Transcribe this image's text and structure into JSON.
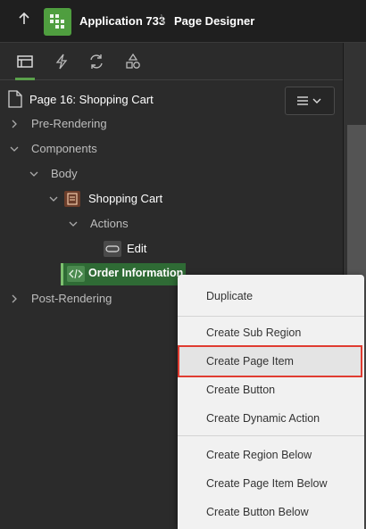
{
  "header": {
    "app_title": "Application 733",
    "separator": "\\",
    "page_title": "Page Designer"
  },
  "tabs": [
    {
      "name": "rendering",
      "icon": "rendering-tree-icon",
      "active": true
    },
    {
      "name": "dynamic-actions",
      "icon": "lightning-icon",
      "active": false
    },
    {
      "name": "processing",
      "icon": "refresh-icon",
      "active": false
    },
    {
      "name": "shared-components",
      "icon": "shapes-icon",
      "active": false
    }
  ],
  "tree": {
    "root_label": "Page 16: Shopping Cart",
    "pre_rendering": "Pre-Rendering",
    "components": "Components",
    "body": "Body",
    "shopping_cart": "Shopping Cart",
    "actions": "Actions",
    "edit": "Edit",
    "order_information": "Order Information",
    "post_rendering": "Post-Rendering"
  },
  "context_menu": {
    "items": [
      "Duplicate",
      "Create Sub Region",
      "Create Page Item",
      "Create Button",
      "Create Dynamic Action",
      "Create Region Below",
      "Create Page Item Below",
      "Create Button Below"
    ],
    "highlighted": "Create Page Item"
  },
  "colors": {
    "accent_green": "#5aa04b",
    "selected_row": "#2f6b35",
    "highlight_border": "#e03c31"
  }
}
